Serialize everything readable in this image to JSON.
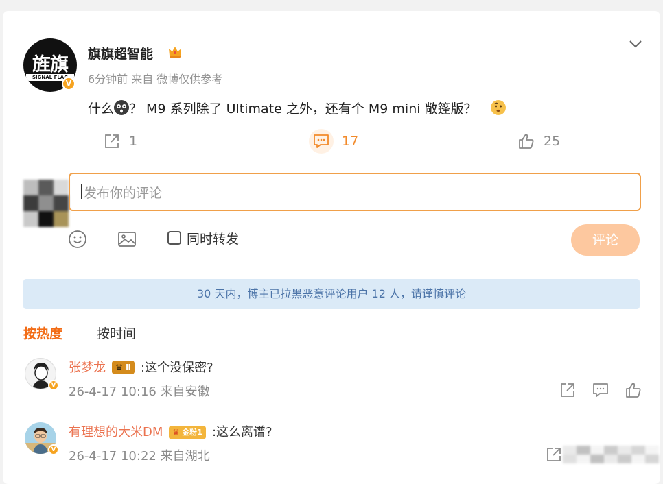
{
  "post": {
    "author": "旗旗超智能",
    "avatar_text": "旌旗",
    "avatar_sub": "SIGNAL FLAG",
    "verified_mark": "V",
    "crown_icon": "crown-icon",
    "meta": "6分钟前  来自 微博仅供参考",
    "content_before": "什么",
    "content_after": "？ M9 系列除了 Ultimate 之外，还有个 M9 mini 敞篷版？",
    "repost_count": "1",
    "comment_count": "17",
    "like_count": "25"
  },
  "composer": {
    "placeholder": "发布你的评论",
    "repost_label": "同时转发",
    "submit_label": "评论"
  },
  "notice": "30 天内，博主已拉黑恶意评论用户 12 人，请谨慎评论",
  "sort": {
    "hot": "按热度",
    "time": "按时间"
  },
  "comments": [
    {
      "name": "张梦龙",
      "badge": "Ⅱ",
      "text": ":这个没保密?",
      "time": "26-4-17 10:16 来自安徽"
    },
    {
      "name": "有理想的大米DM",
      "badge": "金粉1",
      "text": ":这么离谱?",
      "time": "26-4-17 10:22 来自湖北"
    }
  ],
  "colors": {
    "accent": "#f28a2a",
    "name": "#eb7350",
    "notice_bg": "#dbeaf7",
    "notice_text": "#4c74a8",
    "submit_bg": "#fdc89f"
  }
}
